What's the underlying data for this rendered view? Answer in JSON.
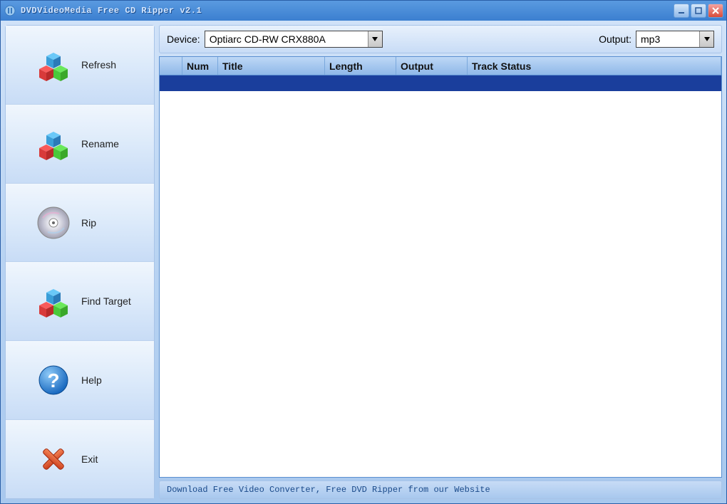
{
  "window": {
    "title": "DVDVideoMedia Free CD Ripper v2.1"
  },
  "sidebar": {
    "items": [
      {
        "label": "Refresh",
        "icon": "cubes"
      },
      {
        "label": "Rename",
        "icon": "cubes"
      },
      {
        "label": "Rip",
        "icon": "disc"
      },
      {
        "label": "Find Target",
        "icon": "cubes"
      },
      {
        "label": "Help",
        "icon": "help"
      },
      {
        "label": "Exit",
        "icon": "cross"
      }
    ]
  },
  "toolbar": {
    "device_label": "Device:",
    "device_value": "Optiarc CD-RW CRX880A",
    "output_label": "Output:",
    "output_value": "mp3"
  },
  "grid": {
    "columns": [
      "",
      "Num",
      "Title",
      "Length",
      "Output",
      "Track Status"
    ]
  },
  "footer": {
    "text": "Download Free Video Converter, Free DVD Ripper from our Website"
  }
}
